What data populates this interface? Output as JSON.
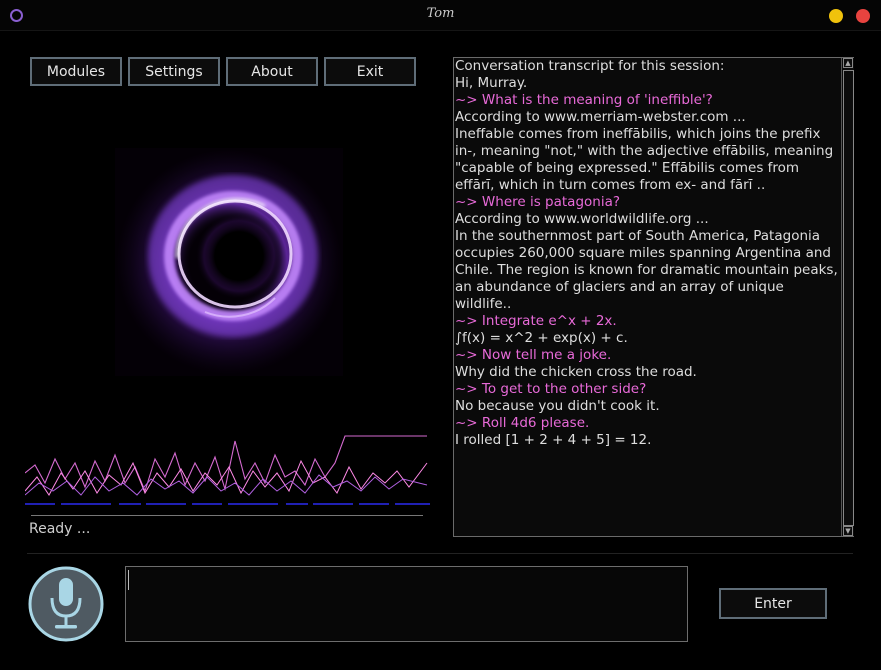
{
  "window": {
    "title": "Tom"
  },
  "nav": {
    "modules": "Modules",
    "settings": "Settings",
    "about": "About",
    "exit": "Exit"
  },
  "status": "Ready ...",
  "transcript": [
    {
      "type": "bot",
      "text": "Conversation transcript for this session:"
    },
    {
      "type": "bot",
      "text": "Hi, Murray."
    },
    {
      "type": "user",
      "text": "~> What is the meaning of 'ineffible'?"
    },
    {
      "type": "bot",
      "text": "According to www.merriam-webster.com ..."
    },
    {
      "type": "bot",
      "text": "Ineffable comes from ineffābilis, which joins the prefix in-, meaning \"not,\" with the adjective effābilis, meaning \"capable of being expressed.\" Effābilis comes from effārī, which in turn comes from ex- and fārī .."
    },
    {
      "type": "user",
      "text": "~> Where is patagonia?"
    },
    {
      "type": "bot",
      "text": "According to www.worldwildlife.org ..."
    },
    {
      "type": "bot",
      "text": "In the southernmost part of South America, Patagonia occupies 260,000 square miles spanning Argentina and Chile. The region is known for dramatic mountain peaks, an abundance of glaciers and an array of unique wildlife.."
    },
    {
      "type": "user",
      "text": "~> Integrate e^x + 2x."
    },
    {
      "type": "bot",
      "text": "∫f(x) = x^2 + exp(x) + c."
    },
    {
      "type": "user",
      "text": "~> Now tell me a joke."
    },
    {
      "type": "bot",
      "text": "Why did the chicken cross the road."
    },
    {
      "type": "user",
      "text": "~> To get to the other side?"
    },
    {
      "type": "bot",
      "text": "No because you didn't cook it."
    },
    {
      "type": "user",
      "text": "~> Roll 4d6 please."
    },
    {
      "type": "bot",
      "text": "I rolled [1 + 2 + 4 + 5] = 12."
    }
  ],
  "input": {
    "value": ""
  },
  "enter": "Enter",
  "colors": {
    "user_text": "#e86ad8",
    "bot_text": "#dedede",
    "orb_accent": "#8a3fd8",
    "button_border": "#5f6d78",
    "mic_ring": "#a9d6e5"
  },
  "icons": {
    "app": "ring-icon",
    "microphone": "microphone-icon"
  }
}
